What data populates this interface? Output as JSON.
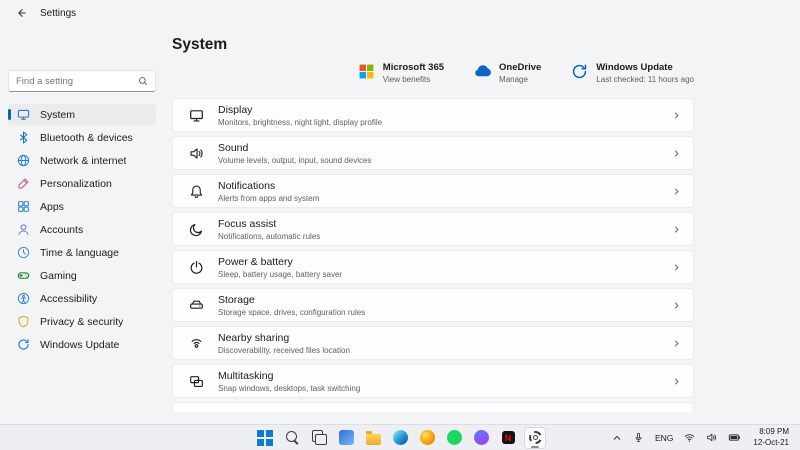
{
  "titlebar": {
    "title": "Settings"
  },
  "sidebar": {
    "search": {
      "placeholder": "Find a setting"
    },
    "items": [
      {
        "label": "System",
        "icon": "system",
        "color": "#3a77c2",
        "active": true
      },
      {
        "label": "Bluetooth & devices",
        "icon": "bluetooth",
        "color": "#1272cc",
        "active": false
      },
      {
        "label": "Network & internet",
        "icon": "network",
        "color": "#1b83d6",
        "active": false
      },
      {
        "label": "Personalization",
        "icon": "personalization",
        "color": "#c255a1",
        "active": false
      },
      {
        "label": "Apps",
        "icon": "apps",
        "color": "#2f80d9",
        "active": false
      },
      {
        "label": "Accounts",
        "icon": "accounts",
        "color": "#5b7ec9",
        "active": false
      },
      {
        "label": "Time & language",
        "icon": "time",
        "color": "#4a90d9",
        "active": false
      },
      {
        "label": "Gaming",
        "icon": "gaming",
        "color": "#107c10",
        "active": false
      },
      {
        "label": "Accessibility",
        "icon": "accessibility",
        "color": "#2f80d9",
        "active": false
      },
      {
        "label": "Privacy & security",
        "icon": "privacy",
        "color": "#d9a82b",
        "active": false
      },
      {
        "label": "Windows Update",
        "icon": "update",
        "color": "#1b83d6",
        "active": false
      }
    ]
  },
  "main": {
    "title": "System",
    "promos": [
      {
        "title": "Microsoft 365",
        "subtitle": "View benefits",
        "icon": "microsoft-365"
      },
      {
        "title": "OneDrive",
        "subtitle": "Manage",
        "icon": "onedrive",
        "color": "#0b64c6"
      },
      {
        "title": "Windows Update",
        "subtitle": "Last checked: 11 hours ago",
        "icon": "update",
        "color": "#0067c0"
      }
    ],
    "cards": [
      {
        "title": "Display",
        "subtitle": "Monitors, brightness, night light, display profile",
        "icon": "display"
      },
      {
        "title": "Sound",
        "subtitle": "Volume levels, output, input, sound devices",
        "icon": "sound"
      },
      {
        "title": "Notifications",
        "subtitle": "Alerts from apps and system",
        "icon": "notifications"
      },
      {
        "title": "Focus assist",
        "subtitle": "Notifications, automatic rules",
        "icon": "focus"
      },
      {
        "title": "Power & battery",
        "subtitle": "Sleep, battery usage, battery saver",
        "icon": "power"
      },
      {
        "title": "Storage",
        "subtitle": "Storage space, drives, configuration rules",
        "icon": "storage"
      },
      {
        "title": "Nearby sharing",
        "subtitle": "Discoverability, received files location",
        "icon": "nearby"
      },
      {
        "title": "Multitasking",
        "subtitle": "Snap windows, desktops, task switching",
        "icon": "multitask"
      }
    ]
  },
  "taskbar": {
    "apps": [
      {
        "name": "start"
      },
      {
        "name": "search"
      },
      {
        "name": "task-view"
      },
      {
        "name": "widgets"
      },
      {
        "name": "file-explorer"
      },
      {
        "name": "edge"
      },
      {
        "name": "firefox"
      },
      {
        "name": "spotify"
      },
      {
        "name": "messenger"
      },
      {
        "name": "netflix"
      },
      {
        "name": "settings",
        "active": true
      }
    ],
    "tray": {
      "language": "ENG",
      "time": "8:09 PM",
      "date": "12-Oct-21"
    }
  },
  "colors": {
    "accent": "#0067c0",
    "background": "#f3f4f6",
    "card": "#fdfdfd",
    "microsoft_logo": [
      "#f25022",
      "#7fba00",
      "#00a4ef",
      "#ffb900"
    ],
    "onedrive_blue": "#0b64c6"
  }
}
